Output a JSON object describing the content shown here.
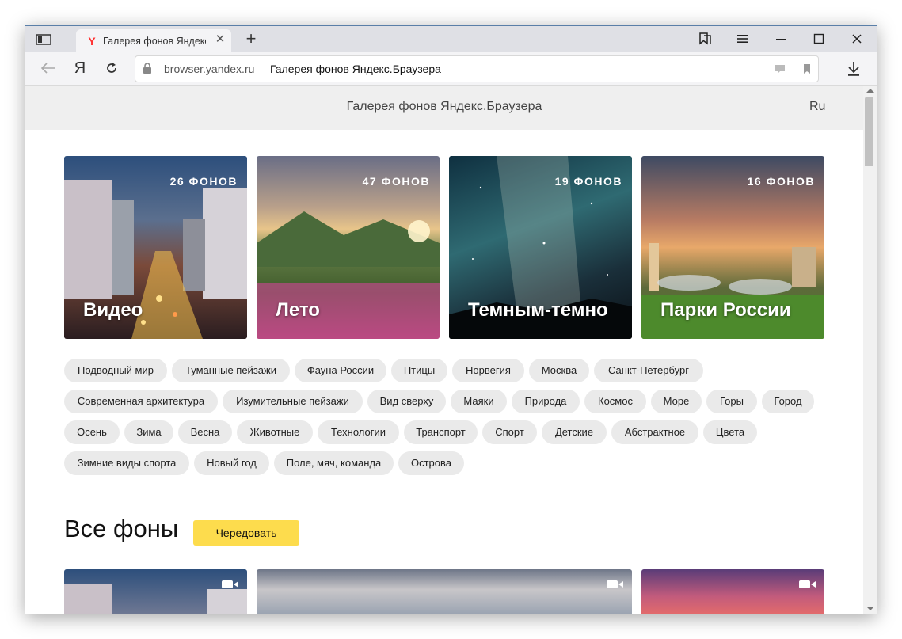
{
  "browser": {
    "tab_title": "Галерея фонов Яндекс.Браузера",
    "tab_favicon": "Y",
    "newtab_label": "+",
    "host": "browser.yandex.ru",
    "page_title": "Галерея фонов Яндекс.Браузера",
    "yandex_button": "Я"
  },
  "header": {
    "title": "Галерея фонов Яндекс.Браузера",
    "lang": "Ru"
  },
  "collections": [
    {
      "name": "Видео",
      "count": "26 ФОНОВ"
    },
    {
      "name": "Лето",
      "count": "47 ФОНОВ"
    },
    {
      "name": "Темным-темно",
      "count": "19 ФОНОВ"
    },
    {
      "name": "Парки России",
      "count": "16 ФОНОВ"
    }
  ],
  "tags": [
    "Подводный мир",
    "Туманные пейзажи",
    "Фауна России",
    "Птицы",
    "Норвегия",
    "Москва",
    "Санкт-Петербург",
    "Современная архитектура",
    "Изумительные пейзажи",
    "Вид сверху",
    "Маяки",
    "Природа",
    "Космос",
    "Море",
    "Горы",
    "Город",
    "Осень",
    "Зима",
    "Весна",
    "Животные",
    "Технологии",
    "Транспорт",
    "Спорт",
    "Детские",
    "Абстрактное",
    "Цвета",
    "Зимние виды спорта",
    "Новый год",
    "Поле, мяч, команда",
    "Острова"
  ],
  "all_section": {
    "title": "Все фоны",
    "shuffle_label": "Чередовать"
  },
  "colors": {
    "accent_button": "#fddc4d",
    "tag_bg": "#eaeaea",
    "header_bg": "#efefef",
    "favicon": "#ff3333"
  }
}
